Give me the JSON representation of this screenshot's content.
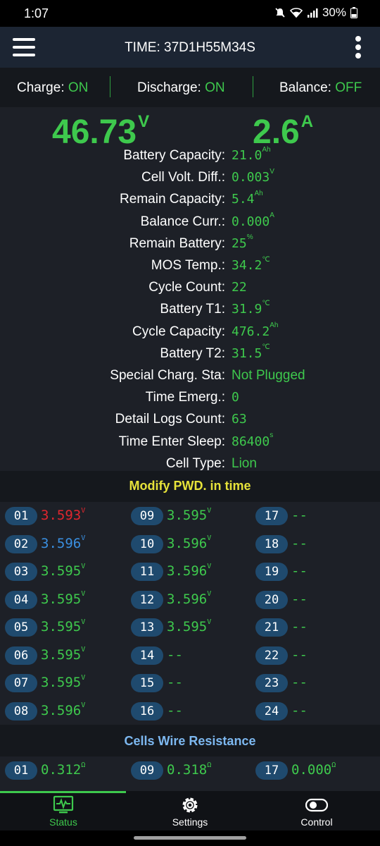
{
  "status_bar": {
    "time": "1:07",
    "battery": "30%"
  },
  "header": {
    "title": "TIME: 37D1H55M34S"
  },
  "switches": [
    {
      "label": "Charge:",
      "value": "ON"
    },
    {
      "label": "Discharge:",
      "value": "ON"
    },
    {
      "label": "Balance:",
      "value": "OFF"
    }
  ],
  "main": {
    "voltage": "46.73",
    "voltage_unit": "V",
    "current": "2.6",
    "current_unit": "A",
    "info": [
      {
        "label": "Battery Capacity:",
        "value": "21.0",
        "unit": "Ah"
      },
      {
        "label": "Cell Volt. Diff.:",
        "value": "0.003",
        "unit": "V"
      },
      {
        "label": "Remain Capacity:",
        "value": "5.4",
        "unit": "Ah"
      },
      {
        "label": "Balance Curr.:",
        "value": "0.000",
        "unit": "A"
      },
      {
        "label": "Remain Battery:",
        "value": "25",
        "unit": "%"
      },
      {
        "label": "MOS Temp.:",
        "value": "34.2",
        "unit": "℃"
      },
      {
        "label": "Cycle Count:",
        "value": "22",
        "unit": ""
      },
      {
        "label": "Battery T1:",
        "value": "31.9",
        "unit": "℃"
      },
      {
        "label": "Cycle Capacity:",
        "value": "476.2",
        "unit": "Ah"
      },
      {
        "label": "Battery T2:",
        "value": "31.5",
        "unit": "℃"
      },
      {
        "label": "Special Charg. Sta:",
        "value": "Not Plugged",
        "unit": ""
      },
      {
        "label": "Time Emerg.:",
        "value": "0",
        "unit": ""
      },
      {
        "label": "Detail Logs Count:",
        "value": "63",
        "unit": ""
      },
      {
        "label": "Time Enter Sleep:",
        "value": "86400",
        "unit": "s"
      },
      {
        "label": "Cell Type:",
        "value": "Lion",
        "unit": ""
      }
    ]
  },
  "voltages_section": {
    "title": "Modify PWD. in time",
    "cells": [
      {
        "id": "01",
        "value": "3.593",
        "unit": "V",
        "color": "#e0262e"
      },
      {
        "id": "02",
        "value": "3.596",
        "unit": "V",
        "color": "#3a8fe0"
      },
      {
        "id": "03",
        "value": "3.595",
        "unit": "V",
        "color": "#3ec94d"
      },
      {
        "id": "04",
        "value": "3.595",
        "unit": "V",
        "color": "#3ec94d"
      },
      {
        "id": "05",
        "value": "3.595",
        "unit": "V",
        "color": "#3ec94d"
      },
      {
        "id": "06",
        "value": "3.595",
        "unit": "V",
        "color": "#3ec94d"
      },
      {
        "id": "07",
        "value": "3.595",
        "unit": "V",
        "color": "#3ec94d"
      },
      {
        "id": "08",
        "value": "3.596",
        "unit": "V",
        "color": "#3ec94d"
      },
      {
        "id": "09",
        "value": "3.595",
        "unit": "V",
        "color": "#3ec94d"
      },
      {
        "id": "10",
        "value": "3.596",
        "unit": "V",
        "color": "#3ec94d"
      },
      {
        "id": "11",
        "value": "3.596",
        "unit": "V",
        "color": "#3ec94d"
      },
      {
        "id": "12",
        "value": "3.596",
        "unit": "V",
        "color": "#3ec94d"
      },
      {
        "id": "13",
        "value": "3.595",
        "unit": "V",
        "color": "#3ec94d"
      },
      {
        "id": "14",
        "value": "--",
        "unit": "",
        "color": "#3ec94d"
      },
      {
        "id": "15",
        "value": "--",
        "unit": "",
        "color": "#3ec94d"
      },
      {
        "id": "16",
        "value": "--",
        "unit": "",
        "color": "#3ec94d"
      },
      {
        "id": "17",
        "value": "--",
        "unit": "",
        "color": "#3ec94d"
      },
      {
        "id": "18",
        "value": "--",
        "unit": "",
        "color": "#3ec94d"
      },
      {
        "id": "19",
        "value": "--",
        "unit": "",
        "color": "#3ec94d"
      },
      {
        "id": "20",
        "value": "--",
        "unit": "",
        "color": "#3ec94d"
      },
      {
        "id": "21",
        "value": "--",
        "unit": "",
        "color": "#3ec94d"
      },
      {
        "id": "22",
        "value": "--",
        "unit": "",
        "color": "#3ec94d"
      },
      {
        "id": "23",
        "value": "--",
        "unit": "",
        "color": "#3ec94d"
      },
      {
        "id": "24",
        "value": "--",
        "unit": "",
        "color": "#3ec94d"
      }
    ]
  },
  "resistance_section": {
    "title": "Cells Wire Resistance",
    "cells": [
      {
        "id": "01",
        "value": "0.312",
        "unit": "Ω",
        "color": "#3ec94d"
      },
      {
        "id": "09",
        "value": "0.318",
        "unit": "Ω",
        "color": "#3ec94d"
      },
      {
        "id": "17",
        "value": "0.000",
        "unit": "Ω",
        "color": "#3ec94d"
      }
    ]
  },
  "bottom_nav": [
    {
      "label": "Status",
      "active": true
    },
    {
      "label": "Settings",
      "active": false
    },
    {
      "label": "Control",
      "active": false
    }
  ]
}
